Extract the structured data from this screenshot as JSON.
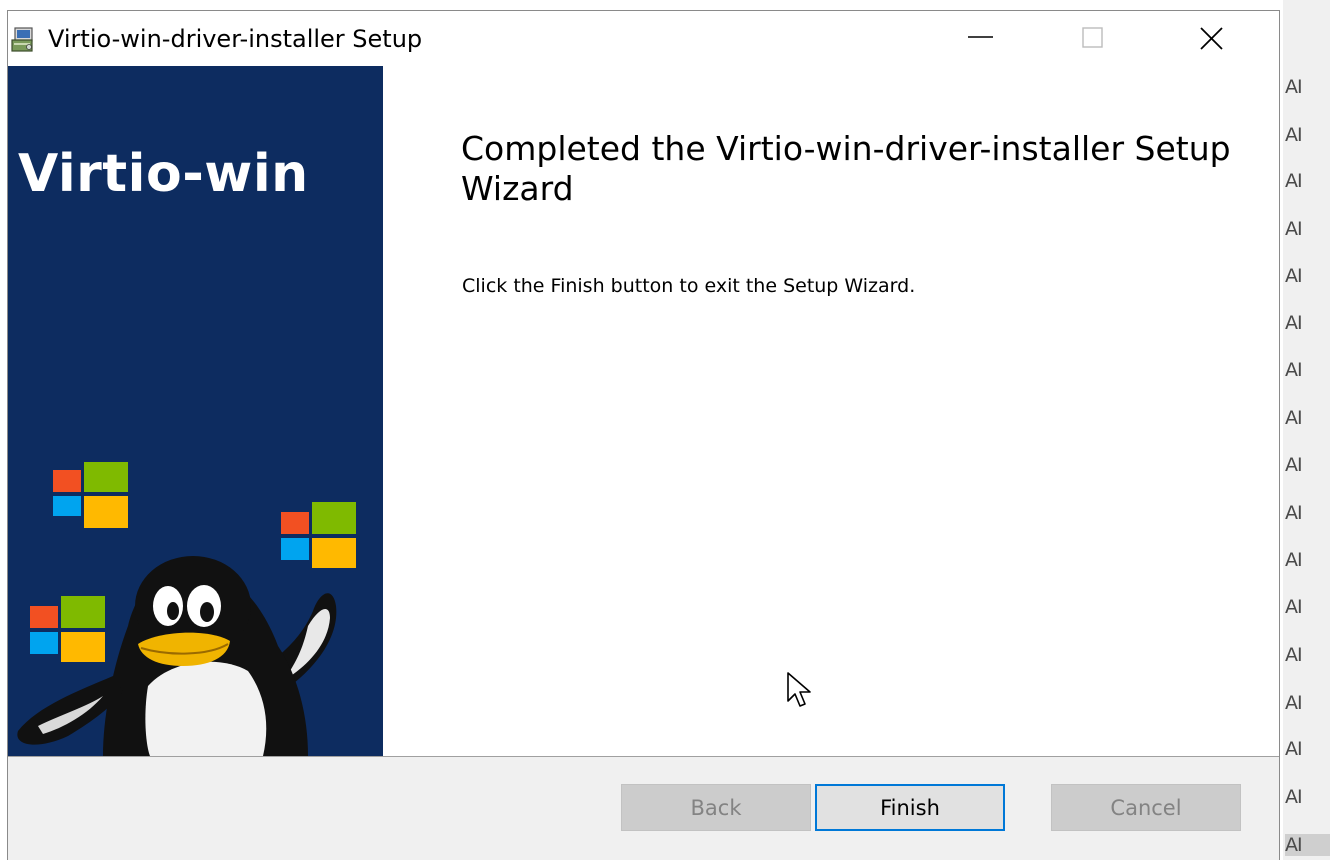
{
  "window": {
    "title": "Virtio-win-driver-installer Setup"
  },
  "banner": {
    "text": "Virtio-win"
  },
  "content": {
    "heading": "Completed the Virtio-win-driver-installer Setup Wizard",
    "body": "Click the Finish button to exit the Setup Wizard."
  },
  "buttons": {
    "back": "Back",
    "finish": "Finish",
    "cancel": "Cancel"
  },
  "background_window": {
    "rows": [
      "AI",
      "AI",
      "AI",
      "AI",
      "AI",
      "AI",
      "AI",
      "AI",
      "AI",
      "AI",
      "AI",
      "AI",
      "AI",
      "AI",
      "AI",
      "AI",
      "AI"
    ]
  },
  "colors": {
    "banner_background": "#0d2c60",
    "accent": "#0078d7",
    "windows_logo": [
      "#f25022",
      "#7fba00",
      "#00a4ef",
      "#ffb900"
    ]
  },
  "icons": [
    "installer-icon",
    "minimize-icon",
    "maximize-icon",
    "close-icon",
    "windows-logo-icon",
    "tux-penguin-icon",
    "mouse-cursor-icon"
  ]
}
